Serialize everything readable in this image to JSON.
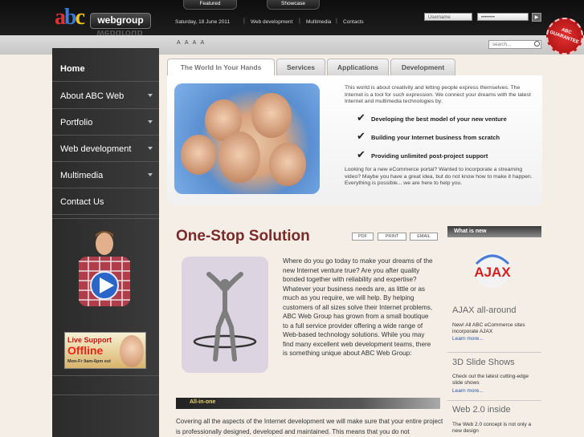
{
  "header": {
    "tabs": [
      "Featured",
      "Showcase"
    ],
    "date": "Saturday, 18 June 2011",
    "nav": [
      "Web development",
      "Multimedia",
      "Contacts"
    ],
    "username_placeholder": "Username",
    "password_value": "••••••••",
    "go_symbol": "▶"
  },
  "logo": {
    "a": "a",
    "b": "b",
    "c": "c",
    "word": "webgroup"
  },
  "seal": {
    "line1": "ABC",
    "line2": "GUARANTEE"
  },
  "toolbar": {
    "font_sizes": "A A A A",
    "search_placeholder": "search..."
  },
  "sidebar": {
    "items": [
      {
        "label": "Home",
        "active": true,
        "submenu": false
      },
      {
        "label": "About ABC Web",
        "submenu": true
      },
      {
        "label": "Portfolio",
        "submenu": true
      },
      {
        "label": "Web development",
        "submenu": true
      },
      {
        "label": "Multimedia",
        "submenu": true
      },
      {
        "label": "Contact Us",
        "submenu": false
      }
    ],
    "live_support": {
      "title": "Live Support",
      "status": "Offline",
      "hours": "Mon-Fr 9am-6pm est"
    }
  },
  "tabs": [
    "The World In Your Hands",
    "Services",
    "Applications",
    "Development"
  ],
  "hero": {
    "intro": "This world is about creativity and letting people express themselves. The Internet is a tool for such expression. We connect your dreams with the latest Internet and multimedia technologies by:",
    "bullets": [
      "Developing the best model of your new venture",
      "Building your Internet business from scratch",
      "Providing unlimited post-project support"
    ],
    "outro": "Looking for a new eCommerce portal? Wanted to incorporate a streaming video? Maybe you have a great idea, but do not know how to make it happen. Everything is possible... we are here to help you."
  },
  "main": {
    "title": "One-Stop Solution",
    "doc_buttons": [
      "PDF",
      "PRINT",
      "EMAIL"
    ],
    "body": "Where do you go today to make your dreams of the new Internet venture true? Are you after quality bonded together with reliability and expertise? Whatever your business needs are, as little or as much as you require, we will help. By helping customers of all sizes solve their Internet problems, ABC Web Group has grown from a small boutique to a full service provider offering a wide range of Web-based technology solutions. While you may find many excellent web development teams, there is something unique about ABC Web Group:",
    "section": "All-in-one",
    "bottom": "Covering all the aspects of the Internet development we will make sure that your entire project is professionally designed, developed and maintained. This means that you do not"
  },
  "whats_new": {
    "header": "What is new",
    "ajax_logo": "AJAX",
    "items": [
      {
        "title": "AJAX all-around",
        "text": "New! All ABC eCommerce sites incorporate AJAX",
        "more": "Learn more..."
      },
      {
        "title": "3D Slide Shows",
        "text": "Check out the latest cutting-edge slide shows",
        "more": "Learn more..."
      },
      {
        "title": "Web 2.0 inside",
        "text": "The Web 2.0 concept is not only a new design"
      }
    ]
  },
  "colors": {
    "title": "#7b2a2a",
    "link": "#2255aa",
    "accent_gold": "#e7d86a",
    "seal_red": "#d32020"
  }
}
